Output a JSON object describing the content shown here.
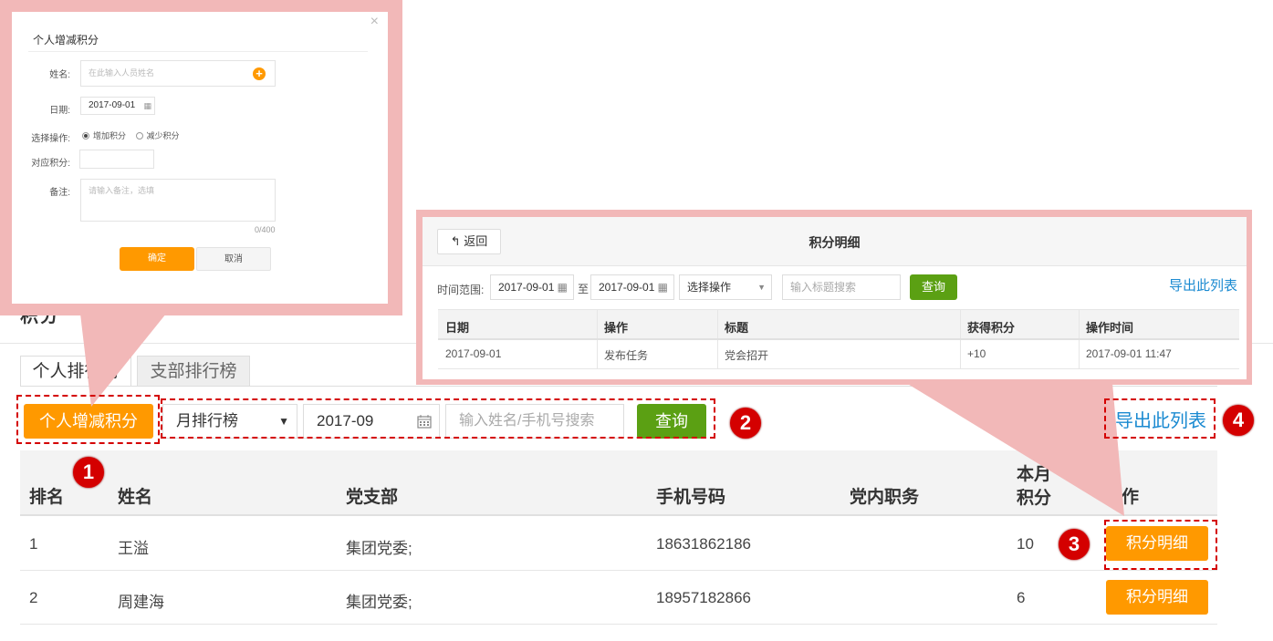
{
  "base": {
    "page_title_partial": "积分",
    "tabs": [
      {
        "label": "个人排行榜",
        "active": true
      },
      {
        "label": "支部排行榜",
        "active": false
      }
    ],
    "toolbar": {
      "add_button": "个人增减积分",
      "rank_select": "月排行榜",
      "select_arrow": "▼",
      "month_value": "2017-09",
      "search_placeholder": "输入姓名/手机号搜索",
      "query_button": "查询",
      "export_link": "导出此列表"
    },
    "table": {
      "headers": {
        "rank": "排名",
        "name": "姓名",
        "branch": "党支部",
        "phone": "手机号码",
        "position": "党内职务",
        "points_line1": "本月",
        "points_line2": "积分",
        "action": "作"
      },
      "rows": [
        {
          "rank": "1",
          "name": "王溢",
          "branch": "集团党委;",
          "phone": "18631862186",
          "position": "",
          "points": "10",
          "action": "积分明细"
        },
        {
          "rank": "2",
          "name": "周建海",
          "branch": "集团党委;",
          "phone": "18957182866",
          "position": "",
          "points": "6",
          "action": "积分明细"
        }
      ]
    }
  },
  "markers": [
    "1",
    "2",
    "3",
    "4"
  ],
  "modal": {
    "title": "个人增减积分",
    "close": "×",
    "name_label": "姓名:",
    "name_placeholder": "在此输入人员姓名",
    "add_icon": "+",
    "date_label": "日期:",
    "date_value": "2017-09-01",
    "op_label": "选择操作:",
    "op_add": "增加积分",
    "op_reduce": "减少积分",
    "points_label": "对应积分:",
    "note_label": "备注:",
    "note_placeholder": "请输入备注，选填",
    "char_count": "0/400",
    "confirm": "确定",
    "cancel": "取消"
  },
  "detail": {
    "back": "返回",
    "back_icon": "↰",
    "title": "积分明细",
    "range_label": "时间范围:",
    "date_from": "2017-09-01",
    "to_label": "至",
    "date_to": "2017-09-01",
    "op_select": "选择操作",
    "search_placeholder": "输入标题搜索",
    "query": "查询",
    "export": "导出此列表",
    "headers": [
      "日期",
      "操作",
      "标题",
      "获得积分",
      "操作时间"
    ],
    "rows": [
      [
        "2017-09-01",
        "发布任务",
        "党会招开",
        "+10",
        "2017-09-01 11:47"
      ]
    ]
  },
  "colors": {
    "accent_orange": "#ff9900",
    "query_green": "#5ba013",
    "link_blue": "#1a8ad1",
    "marker_red": "#d40000",
    "callout_pink": "#f2b8b8"
  }
}
